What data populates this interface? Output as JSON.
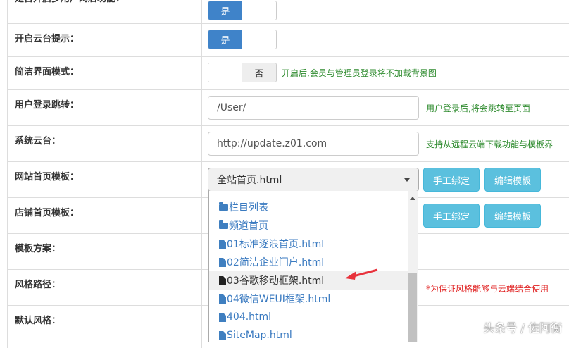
{
  "rows": [
    {
      "label": "是否开启多用户网店功能：",
      "toggle_on": "是"
    },
    {
      "label": "开启云台提示：",
      "toggle_on": "是"
    },
    {
      "label": "简洁界面模式：",
      "toggle_off": "否",
      "hint": "开启后,会员与管理员登录将不加载背景图"
    },
    {
      "label": "用户登录跳转：",
      "value": "/User/",
      "hint": "用户登录后,将会跳转至页面"
    },
    {
      "label": "系统云台：",
      "value": "http://update.z01.com",
      "hint": "支持从远程云端下载功能与模板界"
    },
    {
      "label": "网站首页模板：",
      "select": "全站首页.html",
      "bind_button": "手工绑定",
      "edit_button": "编辑模板"
    },
    {
      "label": "店铺首页模板：",
      "bind_button": "手工绑定",
      "edit_button": "编辑模板"
    },
    {
      "label": "模板方案："
    },
    {
      "label": "风格路径：",
      "hint": "*为保证风格能够与云端结合使用"
    },
    {
      "label": "默认风格："
    }
  ],
  "dropdown": {
    "items": [
      {
        "label": "栏目列表",
        "icon": "folder-icon"
      },
      {
        "label": "频道首页",
        "icon": "folder-icon"
      },
      {
        "label": "01标准逐浪首页.html",
        "icon": "file-icon"
      },
      {
        "label": "02简洁企业门户.html",
        "icon": "file-icon"
      },
      {
        "label": "03谷歌移动框架.html",
        "icon": "file-icon",
        "highlighted": true
      },
      {
        "label": "04微信WEUI框架.html",
        "icon": "file-icon"
      },
      {
        "label": "404.html",
        "icon": "file-icon"
      },
      {
        "label": "SiteMap.html",
        "icon": "file-icon"
      }
    ]
  },
  "watermark": "头条号 / 佐阿衡",
  "colors": {
    "primary": "#3f83c9",
    "info": "#5bc0de",
    "hint_green": "#2e8b2e",
    "hint_red": "#e02020",
    "annotation_arrow": "#e8323c"
  }
}
